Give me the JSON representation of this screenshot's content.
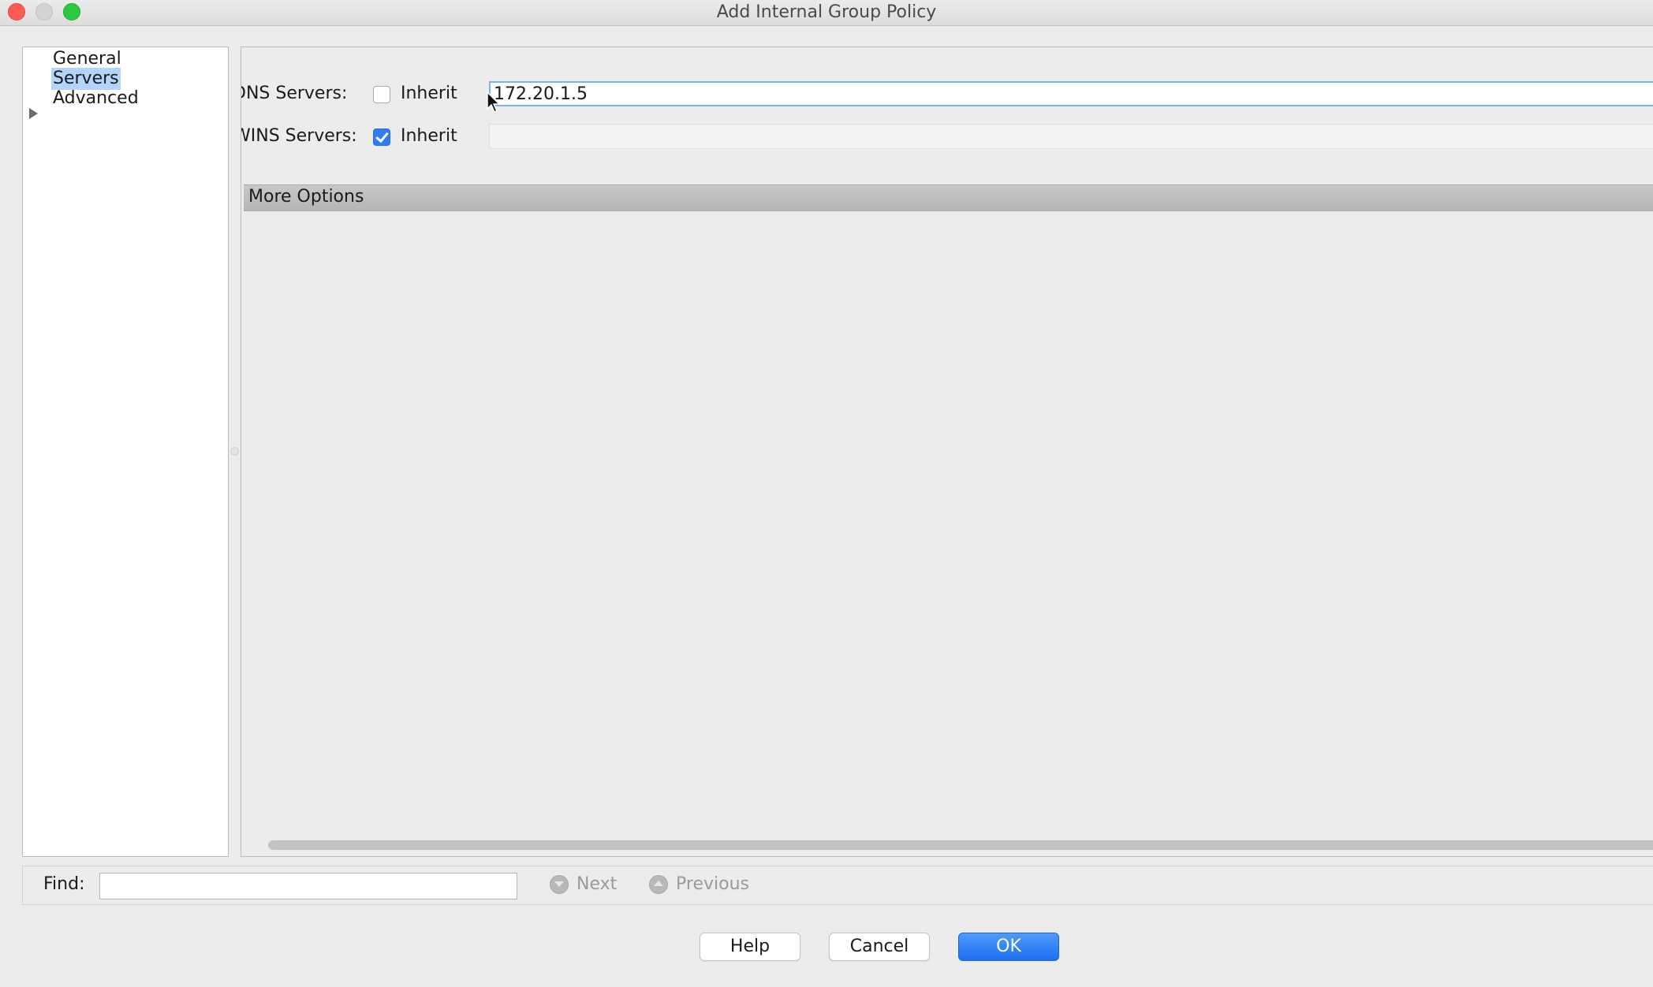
{
  "window": {
    "title": "Add Internal Group Policy"
  },
  "tree": {
    "items": [
      {
        "label": "General",
        "selected": false,
        "expandable": false
      },
      {
        "label": "Servers",
        "selected": true,
        "expandable": false
      },
      {
        "label": "Advanced",
        "selected": false,
        "expandable": true
      }
    ]
  },
  "servers": {
    "dns": {
      "label": "DNS Servers:",
      "inherit_label": "Inherit",
      "inherit_checked": false,
      "value": "172.20.1.5"
    },
    "wins": {
      "label": "WINS Servers:",
      "inherit_label": "Inherit",
      "inherit_checked": true,
      "value": ""
    },
    "more_options_label": "More Options"
  },
  "find_bar": {
    "label": "Find:",
    "value": "",
    "next_label": "Next",
    "previous_label": "Previous"
  },
  "buttons": {
    "help": "Help",
    "cancel": "Cancel",
    "ok": "OK"
  },
  "colors": {
    "selection": "#b3d4fb",
    "primary_button": "#1d6ff2",
    "checkbox_checked": "#2f7cf6"
  }
}
